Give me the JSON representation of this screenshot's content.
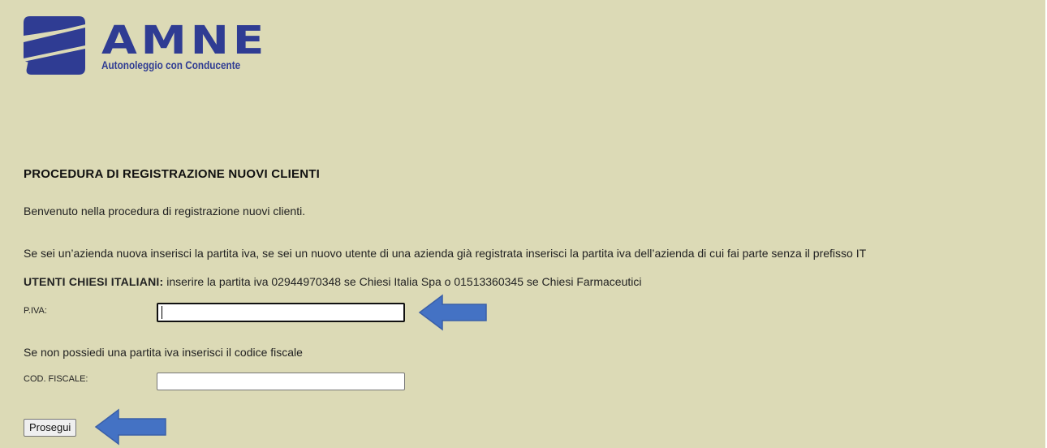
{
  "logo": {
    "brand": "AMNE",
    "tagline": "Autonoleggio con Conducente"
  },
  "form": {
    "title": "PROCEDURA DI REGISTRAZIONE NUOVI CLIENTI",
    "welcome": "Benvenuto nella procedura di registrazione nuovi clienti.",
    "instruction": "Se sei un’azienda nuova inserisci la partita iva, se sei un nuovo utente di una azienda già registrata inserisci la partita iva dell’azienda di cui fai parte senza il prefisso IT",
    "chiesi_strong": "UTENTI CHIESI ITALIANI:",
    "chiesi_text": " inserire la partita iva 02944970348 se Chiesi Italia Spa o 01513360345 se Chiesi Farmaceutici",
    "piva_label": "P.IVA:",
    "piva_value": "",
    "cf_note": "Se non possiedi una partita iva inserisci il codice fiscale",
    "cf_label": "COD. FISCALE:",
    "cf_value": "",
    "proceed_label": "Prosegui"
  },
  "colors": {
    "background": "#dcdab6",
    "brand_blue": "#2f3c93",
    "arrow_blue": "#4472c4"
  }
}
